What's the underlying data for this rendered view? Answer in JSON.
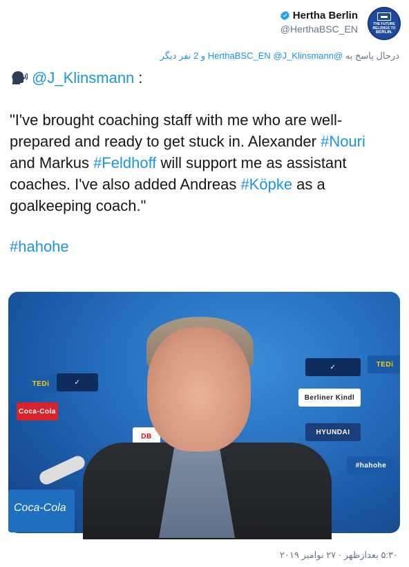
{
  "author": {
    "display_name": "Hertha Berlin",
    "handle": "@HerthaBSC_EN",
    "avatar_text": [
      "THE FUTURE BELONGS TO",
      "BERLIN."
    ]
  },
  "reply_line": {
    "prefix": "درحال پاسخ به ",
    "mentions": "@HerthaBSC_EN @J_Klinsmann",
    "suffix": " و 2 نفر دیگر"
  },
  "tweet": {
    "mention": "@J_Klinsmann",
    "mention_suffix": ":",
    "quote_part1": "\"I've brought coaching staff with me who are well-prepared and ready to get stuck in. Alexander ",
    "hashtag_nouri": "#Nouri",
    "quote_part2": " and Markus ",
    "hashtag_feldhoff": "#Feldhoff",
    "quote_part3": " will support me as assistant coaches. I've also added Andreas ",
    "hashtag_kopke": "#Köpke",
    "quote_part4": " as a goalkeeping coach.\"",
    "hashtag_hahohe": "#hahohe"
  },
  "photo": {
    "sponsor_labels": [
      "TEDi",
      "Berliner Kindl",
      "Coca-Cola",
      "DB",
      "HYUNDAI",
      "#hahohe",
      "Coca-Cola"
    ]
  },
  "timestamp": "۵:۳۰ بعدازظهر · ۲۷ نوامبر ۲۰۱۹",
  "colors": {
    "link": "#1b95e0",
    "secondary_text": "#657786",
    "avatar_bg": "#1f4a9b"
  },
  "icons": {
    "verified": "verified-badge-icon",
    "speaking": "speaking-head-icon"
  }
}
